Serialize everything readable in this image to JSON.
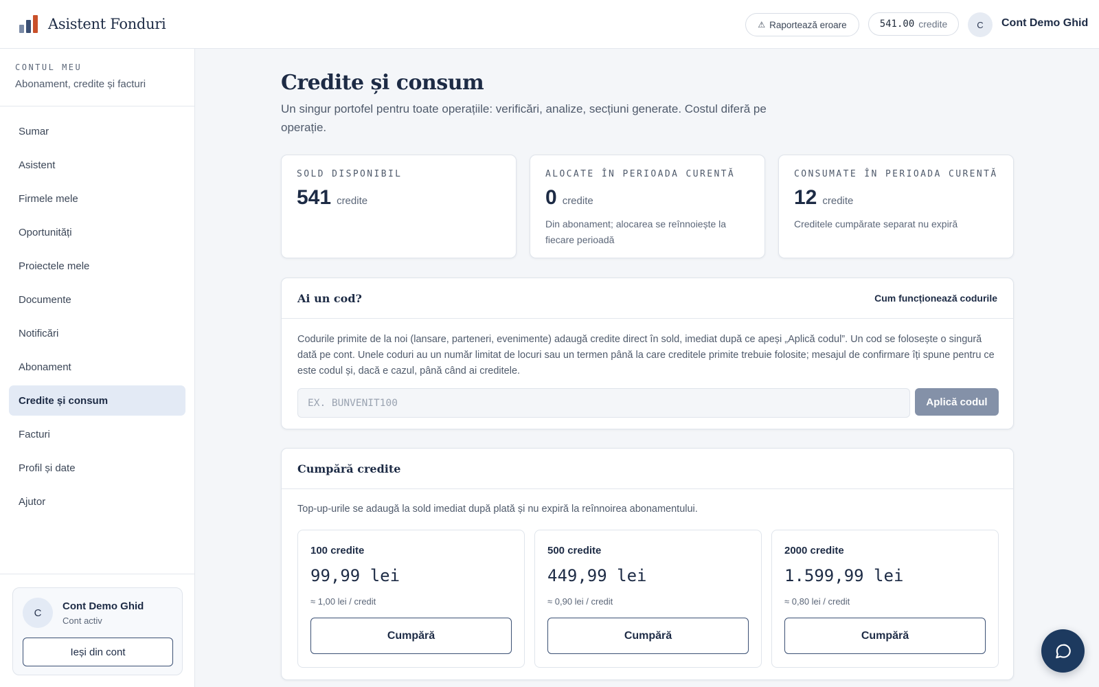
{
  "header": {
    "brand": "Asistent Fonduri",
    "report_label": "Raportează eroare",
    "credit_amount": "541.00",
    "credit_unit": "credite",
    "avatar_initial": "C",
    "account_name": "Cont Demo Ghid"
  },
  "sidebar": {
    "kicker": "CONTUL MEU",
    "subtitle": "Abonament, credite și facturi",
    "items": [
      {
        "label": "Sumar"
      },
      {
        "label": "Asistent"
      },
      {
        "label": "Firmele mele"
      },
      {
        "label": "Oportunități"
      },
      {
        "label": "Proiectele mele"
      },
      {
        "label": "Documente"
      },
      {
        "label": "Notificări"
      },
      {
        "label": "Abonament"
      },
      {
        "label": "Credite și consum",
        "active": true
      },
      {
        "label": "Facturi"
      },
      {
        "label": "Profil și date"
      },
      {
        "label": "Ajutor"
      }
    ],
    "user": {
      "initial": "C",
      "name": "Cont Demo Ghid",
      "status": "Cont activ",
      "logout_label": "Ieși din cont"
    }
  },
  "main": {
    "title": "Credite și consum",
    "description": "Un singur portofel pentru toate operațiile: verificări, analize, secțiuni generate. Costul diferă pe operație.",
    "stats": [
      {
        "kicker": "SOLD DISPONIBIL",
        "value": "541",
        "unit": "credite",
        "note": ""
      },
      {
        "kicker": "ALOCATE ÎN PERIOADA CURENTĂ",
        "value": "0",
        "unit": "credite",
        "note": "Din abonament; alocarea se reînnoiește la fiecare perioadă"
      },
      {
        "kicker": "CONSUMATE ÎN PERIOADA CURENTĂ",
        "value": "12",
        "unit": "credite",
        "note": "Creditele cumpărate separat nu expiră"
      }
    ],
    "code": {
      "title": "Ai un cod?",
      "link": "Cum funcționează codurile",
      "text": "Codurile primite de la noi (lansare, parteneri, evenimente) adaugă credite direct în sold, imediat după ce apeși „Aplică codul”. Un cod se folosește o singură dată pe cont. Unele coduri au un număr limitat de locuri sau un termen până la care creditele primite trebuie folosite; mesajul de confirmare îți spune pentru ce este codul și, dacă e cazul, până când ai creditele.",
      "placeholder": "EX. BUNVENIT100",
      "value": "",
      "apply_label": "Aplică codul"
    },
    "buy": {
      "title": "Cumpără credite",
      "note": "Top-up-urile se adaugă la sold imediat după plată și nu expiră la reînnoirea abonamentului.",
      "packs": [
        {
          "name": "100 credite",
          "price": "99,99 lei",
          "rate": "≈ 1,00 lei / credit",
          "button": "Cumpără"
        },
        {
          "name": "500 credite",
          "price": "449,99 lei",
          "rate": "≈ 0,90 lei / credit",
          "button": "Cumpără"
        },
        {
          "name": "2000 credite",
          "price": "1.599,99 lei",
          "rate": "≈ 0,80 lei / credit",
          "button": "Cumpără"
        }
      ]
    }
  },
  "icons": {
    "warning": "warning-icon",
    "logo": "bar-chart-logo-icon",
    "chat": "chat-bubble-icon"
  },
  "colors": {
    "accent": "#1d3a5f",
    "active_nav_bg": "#e3eaf5",
    "apply_button": "#8491a8",
    "logo_orange": "#c9502a"
  }
}
